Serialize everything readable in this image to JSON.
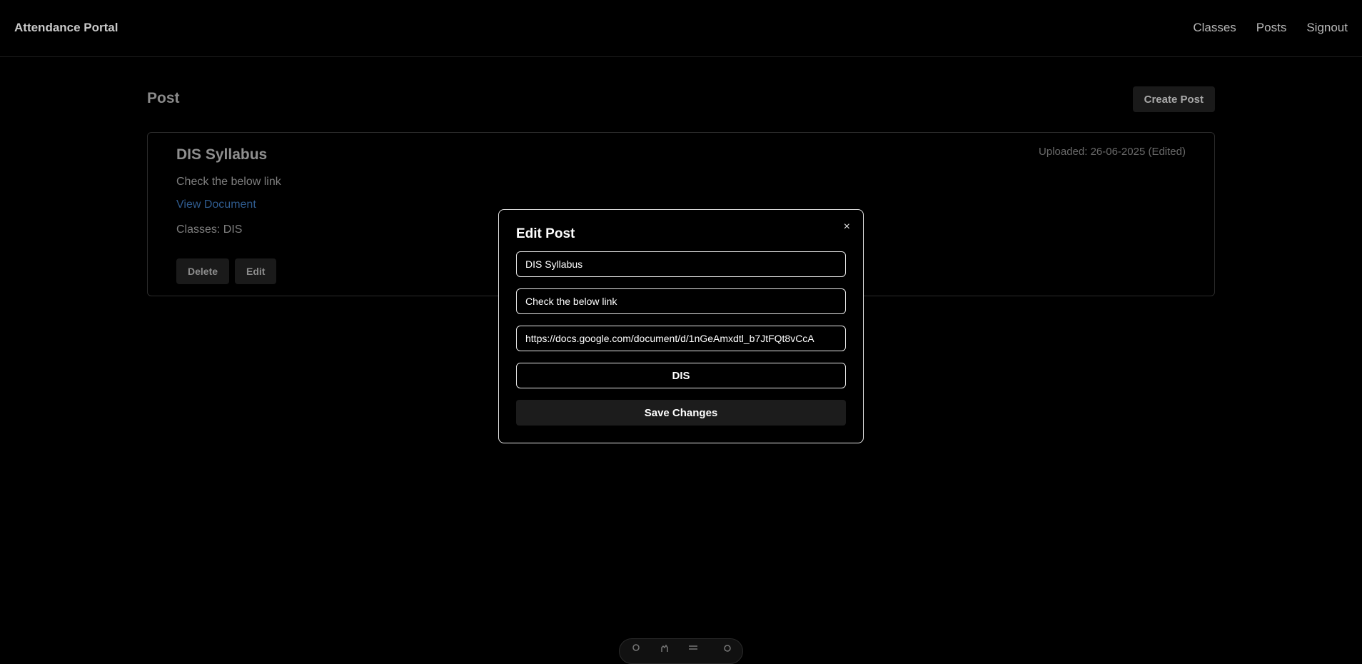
{
  "navbar": {
    "brand": "Attendance Portal",
    "links": [
      "Classes",
      "Posts",
      "Signout"
    ]
  },
  "page": {
    "title": "Post",
    "create_button": "Create Post"
  },
  "post": {
    "title": "DIS Syllabus",
    "uploaded": "Uploaded: 26-06-2025 (Edited)",
    "description": "Check the below link",
    "link_label": "View Document",
    "classes": "Classes: DIS",
    "delete_label": "Delete",
    "edit_label": "Edit"
  },
  "modal": {
    "title": "Edit Post",
    "close_symbol": "×",
    "title_value": "DIS Syllabus",
    "description_value": "Check the below link",
    "url_value": "https://docs.google.com/document/d/1nGeAmxdtl_b7JtFQt8vCcA",
    "class_selected": "DIS",
    "save_label": "Save Changes"
  },
  "toolbar": {
    "icons": [
      "user-icon",
      "hand-icon",
      "menu-icon",
      "gear-icon"
    ]
  }
}
